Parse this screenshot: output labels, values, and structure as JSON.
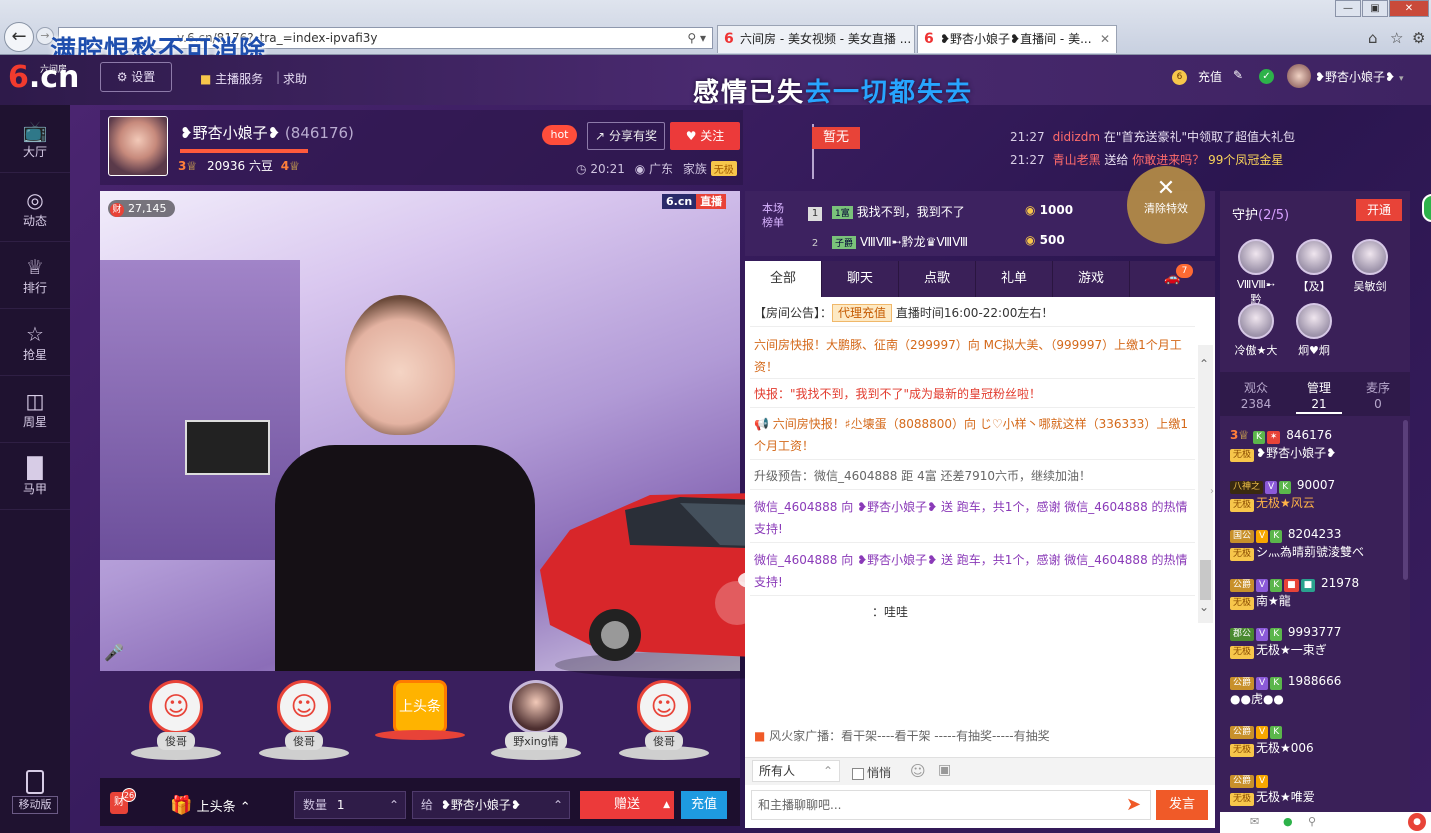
{
  "browser": {
    "url": "v.6.cn/8176?_tra_=index-ipvafi3y",
    "url_prefix_hidden": "",
    "tabs": [
      {
        "label": "六间房 - 美女视频 - 美女直播 ..."
      },
      {
        "label": "❥野杏小娘子❥直播间 - 美..."
      }
    ],
    "overlay_text": "满腔恨愁不可消除"
  },
  "topnav": {
    "logo_text": ".cn",
    "logo_six": "6",
    "logo_small": "六间房",
    "settings": "设置",
    "host_service": "主播服务",
    "help": "求助",
    "banner_left": "感情已失",
    "banner_right": "去一切都失去",
    "recharge": "充值",
    "username": "❥野杏小娘子❥"
  },
  "sidebar": {
    "items": [
      {
        "label": "大厅",
        "icon": "tv-icon"
      },
      {
        "label": "动态",
        "icon": "compass-icon"
      },
      {
        "label": "排行",
        "icon": "crown-icon"
      },
      {
        "label": "抢星",
        "icon": "star-icon"
      },
      {
        "label": "周星",
        "icon": "gift-box-icon"
      },
      {
        "label": "马甲",
        "icon": "shirt-icon"
      }
    ],
    "mobile": "移动版"
  },
  "host": {
    "name": "❥野杏小娘子❥",
    "id": "(846176)",
    "level_left": "3",
    "beans": "20936 六豆",
    "level_right": "4",
    "hot": "hot",
    "share": "分享有奖",
    "follow": "关注",
    "time": "20:21",
    "location": "广东",
    "family": "家族",
    "family_badge": "无极",
    "flag_label": "暂无"
  },
  "notices": [
    {
      "time": "21:27",
      "name": "didizdm",
      "text": " 在\"首充送豪礼\"中领取了超值大礼包"
    },
    {
      "time": "21:27",
      "name": "青山老黑",
      "text": " 送给 ",
      "target": "你敢进来吗？",
      "gift": " 99个凤冠金星"
    }
  ],
  "video": {
    "fortune_icon": "财",
    "fortune_count": "27,145",
    "brand_a": "6.cn",
    "brand_b": "直播"
  },
  "gifts": [
    {
      "label": "俊哥"
    },
    {
      "label": "俊哥"
    },
    {
      "label": "上头条",
      "badge": "上头条"
    },
    {
      "label": "野xing情"
    },
    {
      "label": "俊哥"
    }
  ],
  "bottombar": {
    "coin": "财",
    "coin_badge": "26",
    "headline": "上头条",
    "qty_label": "数量",
    "qty_value": "1",
    "to_label": "给",
    "to_name": "❥野杏小娘子❥",
    "send": "赠送",
    "recharge": "充值"
  },
  "rank": {
    "label_line1": "本场",
    "label_line2": "榜单",
    "rows": [
      {
        "num": "1",
        "badge": "1富",
        "name": "我找不到，我到不了",
        "coins": "1000"
      },
      {
        "num": "2",
        "badge": "子爵",
        "name": "ⅧⅧ➸黔龙♛ⅧⅧ",
        "coins": "500"
      }
    ],
    "clear_effects": "清除特效"
  },
  "chat": {
    "tabs": [
      "全部",
      "聊天",
      "点歌",
      "礼单",
      "游戏"
    ],
    "car_badge": "7",
    "announcement_prefix": "【房间公告】：",
    "announcement_tag": "代理充值",
    "announcement_text": "直播时间16:00-22:00左右！",
    "messages": [
      {
        "text": "六间房快报！大鹏豚、征南（299997）向 MC拟大美、（999997）上缴1个月工资！"
      },
      {
        "text": "快报：\"我找不到，我到不了\"成为最新的皇冠粉丝啦！"
      },
      {
        "text": "六间房快报！♯尐壊蛋（8088800）向 じ♡小样丶哪就这样（336333）上缴1个月工资！"
      },
      {
        "text": "升级预告：微信_4604888 距 4富 还差7910六币，继续加油！"
      },
      {
        "text": "微信_4604888 向 ❥野杏小娘子❥ 送 跑车，共1个，感谢 微信_4604888 的热情支持!"
      },
      {
        "text": "微信_4604888 向 ❥野杏小娘子❥ 送 跑车，共1个，感谢 微信_4604888 的热情支持!"
      },
      {
        "text": "：哇哇"
      }
    ],
    "broadcast": "风火家广播：看干架----看干架 -----有抽奖-----有抽奖",
    "audience_select": "所有人",
    "quiet": "悄悄",
    "input_placeholder": "和主播聊聊吧...",
    "send": "发言"
  },
  "guard": {
    "title": "守护",
    "count": "(2/5)",
    "open": "开通",
    "members": [
      {
        "name": "ⅧⅧ➸黔"
      },
      {
        "name": "【及】"
      },
      {
        "name": "吴敏剑"
      },
      {
        "name": "冷傲★大"
      },
      {
        "name": "炯♥炯"
      }
    ],
    "tabs": [
      {
        "label": "观众",
        "count": "2384"
      },
      {
        "label": "管理",
        "count": "21"
      },
      {
        "label": "麦序",
        "count": "0"
      }
    ],
    "users": [
      {
        "pre": "3",
        "id": "846176",
        "badge": "无极",
        "name": "❥野杏小娘子❥"
      },
      {
        "pre": "八神之",
        "id": "90007",
        "badge": "无极",
        "name": "无极★风云"
      },
      {
        "pre": "国公",
        "id": "8204233",
        "badge": "无极",
        "name": "シ灬為晴莂號淩雙べ"
      },
      {
        "pre": "公爵",
        "id": "21978",
        "badge": "无极",
        "name": "南★龍"
      },
      {
        "pre": "郡公",
        "id": "9993777",
        "badge": "无极",
        "name": "无极★一束ぎ"
      },
      {
        "pre": "公爵",
        "id": "1988666",
        "badge": "",
        "name": "●●虎●●"
      },
      {
        "pre": "公爵",
        "id": "",
        "badge": "无极",
        "name": "无极★006"
      },
      {
        "pre": "公爵",
        "id": "",
        "badge": "无极",
        "name": "无极★唯爱"
      }
    ]
  },
  "colors": {
    "accent_red": "#e84338",
    "bg_purple": "#3a1d5c",
    "link_blue": "#1e9ae0"
  }
}
